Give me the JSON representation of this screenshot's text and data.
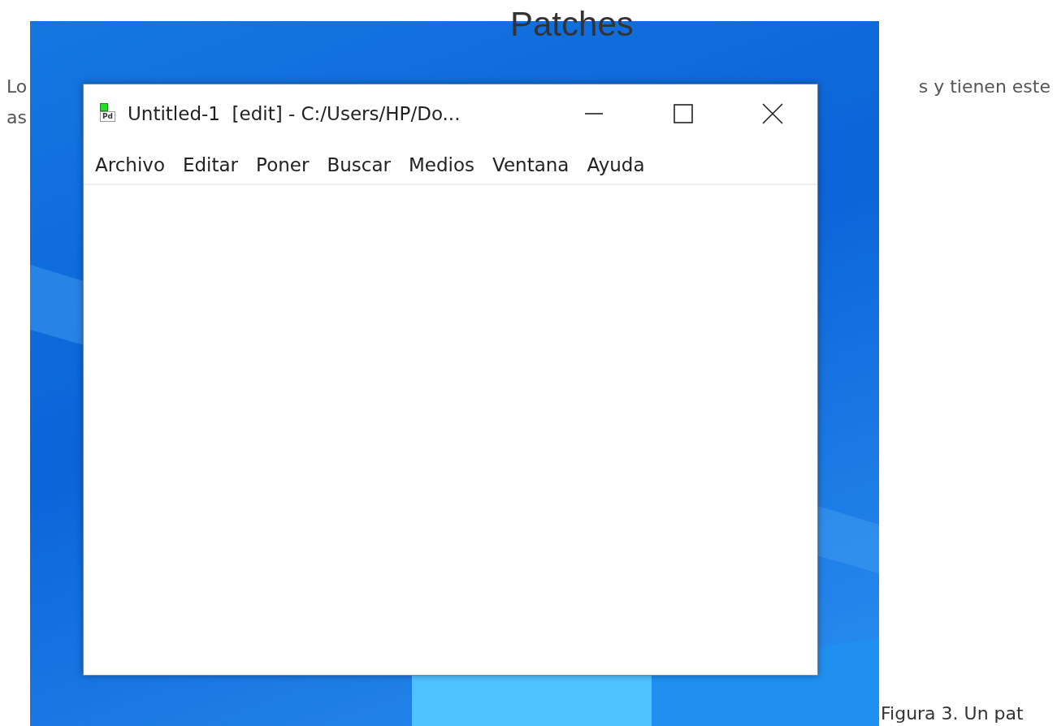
{
  "heading": "Patches",
  "paragraph": {
    "line_1_start": "Lo",
    "line_1_end": "s y tienen este",
    "line_2_start": "as"
  },
  "figure": {
    "window": {
      "icon_text": "Pd",
      "title": "Untitled-1  [edit] - C:/Users/HP/Do...",
      "menu": [
        "Archivo",
        "Editar",
        "Poner",
        "Buscar",
        "Medios",
        "Ventana",
        "Ayuda"
      ]
    },
    "caption": "Figura 3. Un pat"
  }
}
